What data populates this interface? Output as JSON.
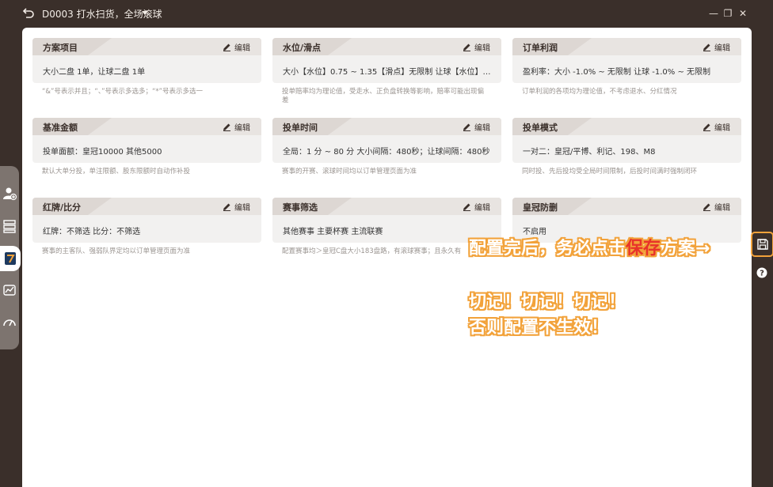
{
  "window": {
    "title": "D0003 打水扫货，全场滚球",
    "min_glyph": "—",
    "restore_glyph": "❐",
    "close_glyph": "✕"
  },
  "cards": [
    {
      "title": "方案项目",
      "edit": "编辑",
      "value": "大小二盘 1单，让球二盘 1单",
      "hint": "“&”号表示并且；“、”号表示多选多；“*”号表示多选一"
    },
    {
      "title": "水位/滑点",
      "edit": "编辑",
      "value": "大小【水位】0.75 ~ 1.35【滑点】无限制    让球【水位】0.…",
      "hint": "投单赔率均为理论值，受走水、正负盘转换等影响，赔率可能出现偏差"
    },
    {
      "title": "订单利润",
      "edit": "编辑",
      "value": "盈利率：大小 -1.0% ~ 无限制    让球 -1.0% ~ 无限制",
      "hint": "订单利润的各项均为理论值，不考虑退水、分红情况"
    },
    {
      "title": "基准金额",
      "edit": "编辑",
      "value": "投单面额：皇冠10000    其他5000",
      "hint": "默认大单分投，单注限额、股东限额时自动作补投"
    },
    {
      "title": "投单时间",
      "edit": "编辑",
      "value": "全局：1 分 ~ 80 分    大小间隔：480秒；让球间隔：480秒",
      "hint": "赛事的开赛、滚球时间均以订单管理页面为准"
    },
    {
      "title": "投单模式",
      "edit": "编辑",
      "value": "一对二：皇冠/平博、利记、198、M8",
      "hint": "同时投、先后投均受全局时间限制，后投时间满时强制闭环"
    },
    {
      "title": "红牌/比分",
      "edit": "编辑",
      "value": "红牌：不筛选    比分：不筛选",
      "hint": "赛事的主客队、强弱队界定均以订单管理页面为准"
    },
    {
      "title": "赛事筛选",
      "edit": "编辑",
      "value": "其他赛事    主要杯赛    主流联赛",
      "hint": "配置赛事均＞皇冠C盘大小183盘路，有滚球赛事；且永久有"
    },
    {
      "title": "皇冠防删",
      "edit": "编辑",
      "value": "不启用",
      "hint": "或"
    }
  ],
  "annotation": {
    "line1_a": "配置完后，务必点击",
    "line1_b": "保存",
    "line1_c": "方案→",
    "line2": "切记！切记！切记！",
    "line3": "否则配置不生效！"
  },
  "colors": {
    "background": "#3a2f2a",
    "accent": "#f2a23a",
    "warn_red": "#e8332a",
    "card_bg": "#f2f1f0",
    "card_head": "#ddd7d3"
  },
  "icons": [
    "back-icon",
    "caret-down-icon",
    "minimize-icon",
    "restore-icon",
    "close-icon",
    "add-user-icon",
    "server-icon",
    "app-icon",
    "chart-icon",
    "gauge-icon",
    "pencil-icon",
    "save-icon",
    "help-icon"
  ]
}
